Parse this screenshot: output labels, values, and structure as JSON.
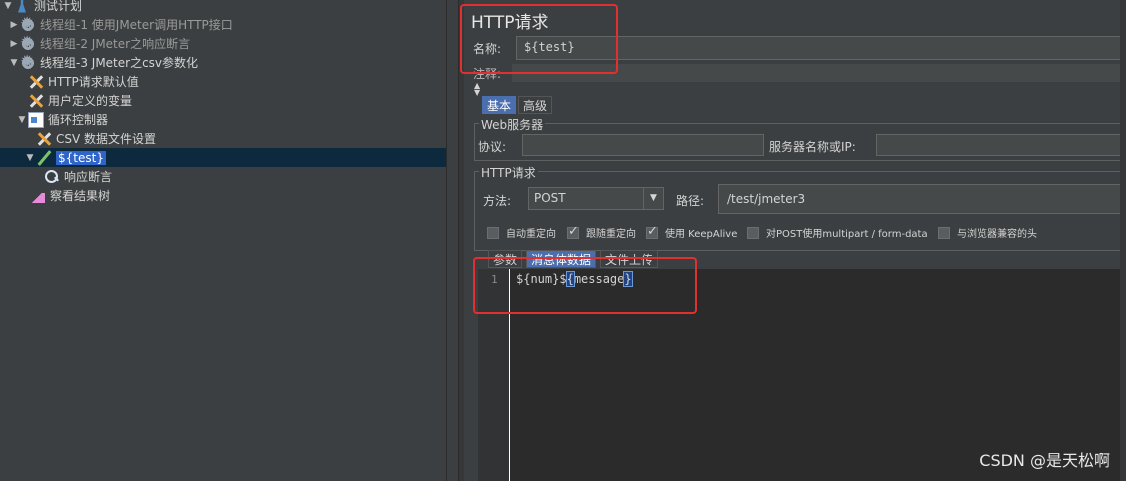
{
  "tree": {
    "items": [
      {
        "label": "测试计划",
        "icon": "flask-icon",
        "arrow": "▼"
      },
      {
        "label": "线程组-1 使用JMeter调用HTTP接口",
        "icon": "gear-icon",
        "arrow": "▶"
      },
      {
        "label": "线程组-2 JMeter之响应断言",
        "icon": "gear-icon",
        "arrow": "▶"
      },
      {
        "label": "线程组-3 JMeter之csv参数化",
        "icon": "gear-icon",
        "arrow": "▼"
      },
      {
        "label": "HTTP请求默认值",
        "icon": "tool-icon"
      },
      {
        "label": "用户定义的变量",
        "icon": "tool-icon"
      },
      {
        "label": "循环控制器",
        "icon": "loop-icon",
        "arrow": "▼"
      },
      {
        "label": "CSV 数据文件设置",
        "icon": "tool-icon"
      },
      {
        "label": "${test}",
        "icon": "pen-icon",
        "arrow": "▼"
      },
      {
        "label": "响应断言",
        "icon": "search-icon"
      },
      {
        "label": "察看结果树",
        "icon": "graph-icon"
      }
    ]
  },
  "panel": {
    "title": "HTTP请求",
    "name_label": "名称:",
    "name_value": "${test}",
    "comment_label": "注释:"
  },
  "tabs": {
    "basic": "基本",
    "advanced": "高级"
  },
  "web_server": {
    "title": "Web服务器",
    "protocol_label": "协议:",
    "protocol_value": "",
    "server_label": "服务器名称或IP:",
    "server_value": ""
  },
  "http_request": {
    "title": "HTTP请求",
    "method_label": "方法:",
    "method_value": "POST",
    "path_label": "路径:",
    "path_value": "/test/jmeter3"
  },
  "checkboxes": [
    {
      "label": "自动重定向",
      "checked": false
    },
    {
      "label": "跟随重定向",
      "checked": true
    },
    {
      "label": "使用 KeepAlive",
      "checked": true
    },
    {
      "label": "对POST使用multipart / form-data",
      "checked": false
    },
    {
      "label": "与浏览器兼容的头",
      "checked": false
    }
  ],
  "body_tabs": {
    "params": "参数",
    "body": "消息体数据",
    "files": "文件上传"
  },
  "editor": {
    "line_number": "1",
    "code_a": "${num}$",
    "code_b": "{",
    "code_c": "message",
    "code_d": "}"
  },
  "watermark": "CSDN @是天松啊",
  "colors": {
    "selection": "#2f65ca",
    "annotation": "#e03030",
    "tab_active": "#4b6eaf"
  }
}
